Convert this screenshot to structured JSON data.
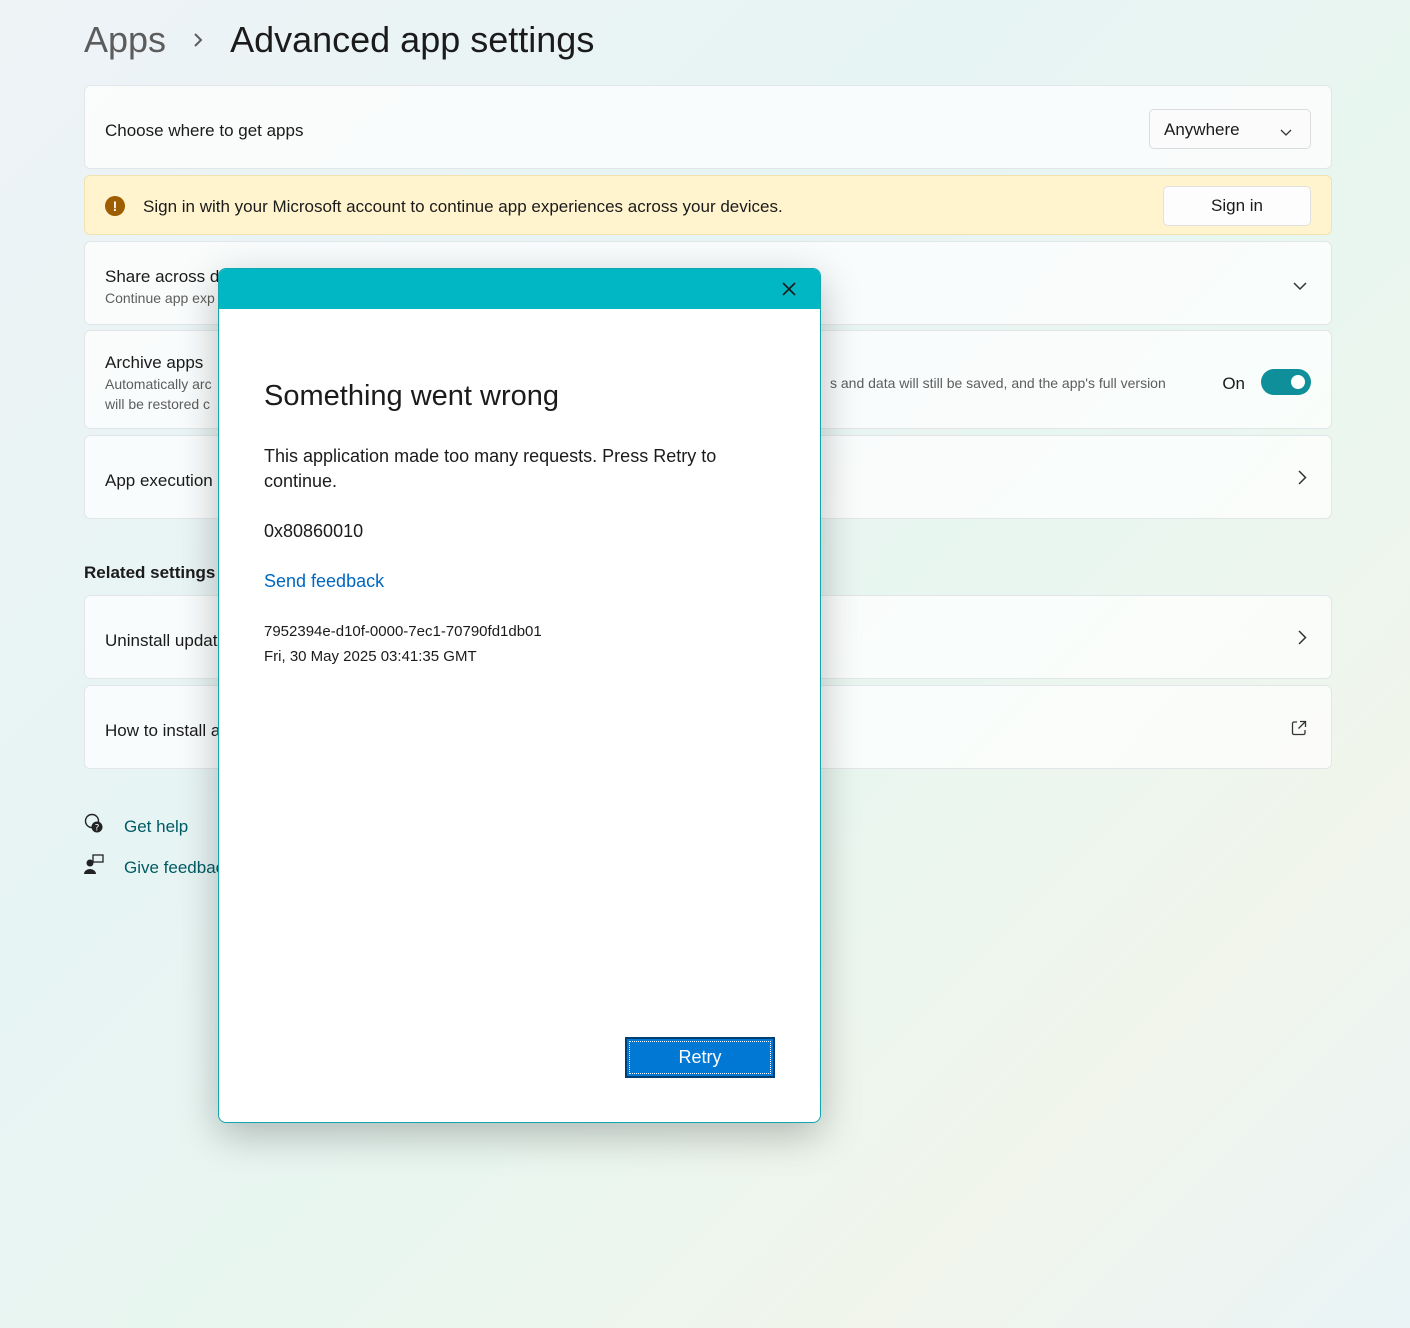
{
  "breadcrumb": {
    "parent": "Apps",
    "current": "Advanced app settings"
  },
  "choose_apps": {
    "title": "Choose where to get apps",
    "dropdown_value": "Anywhere"
  },
  "banner": {
    "message": "Sign in with your Microsoft account to continue app experiences across your devices.",
    "button": "Sign in"
  },
  "share": {
    "title": "Share across de",
    "subtitle": "Continue app exp"
  },
  "archive": {
    "title": "Archive apps",
    "subtitle_line1": "Automatically arc",
    "subtitle_line2": "will be restored c",
    "subtitle_visible_right": "s and data will still be saved, and the app's full version",
    "toggle_label": "On",
    "toggle_on": true
  },
  "app_execution": {
    "title": "App execution"
  },
  "related": {
    "heading": "Related settings",
    "uninstall": "Uninstall updat",
    "how_to_install": "How to install a"
  },
  "help_links": {
    "get_help": "Get help",
    "give_feedback": "Give feedbac"
  },
  "dialog": {
    "heading": "Something went wrong",
    "body": "This application made too many requests. Press Retry to continue.",
    "code": "0x80860010",
    "feedback_link": "Send feedback",
    "correlation_id": "7952394e-d10f-0000-7ec1-70790fd1db01",
    "timestamp": "Fri, 30 May 2025 03:41:35 GMT",
    "retry_button": "Retry"
  },
  "colors": {
    "accent_teal": "#00b7c3",
    "toggle_on": "#0f8f9a",
    "retry_blue": "#0078d4",
    "link_blue": "#0067c0",
    "banner_bg": "#fff4ce"
  }
}
